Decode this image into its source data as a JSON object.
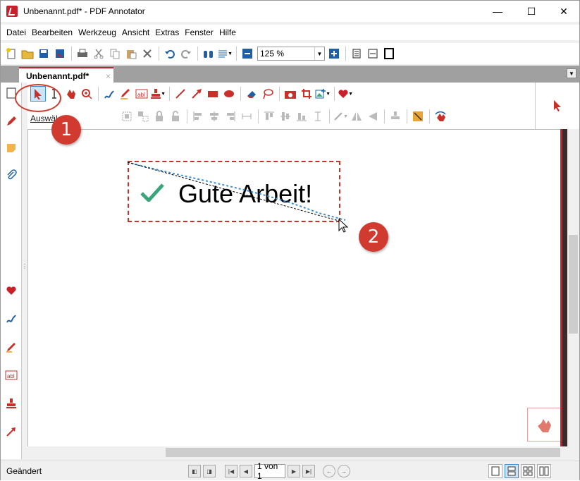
{
  "window": {
    "title": "Unbenannt.pdf* - PDF Annotator",
    "minimize": "—",
    "maximize": "☐",
    "close": "✕"
  },
  "menu": [
    "Datei",
    "Bearbeiten",
    "Werkzeug",
    "Ansicht",
    "Extras",
    "Fenster",
    "Hilfe"
  ],
  "toolbar": {
    "zoom_value": "125 %"
  },
  "tabs": {
    "active": "Unbenannt.pdf*",
    "close": "×"
  },
  "annotation_toolbar": {
    "row2_label": "Auswäh"
  },
  "document": {
    "annotation_text": "Gute Arbeit!"
  },
  "callouts": [
    "1",
    "2"
  ],
  "status": {
    "text": "Geändert",
    "page_field": "1 von 1"
  },
  "colors": {
    "accent_red": "#c8202a",
    "callout_red": "#d03a2f",
    "check_green": "#3aa57a",
    "select_blue": "#cce4f7"
  }
}
